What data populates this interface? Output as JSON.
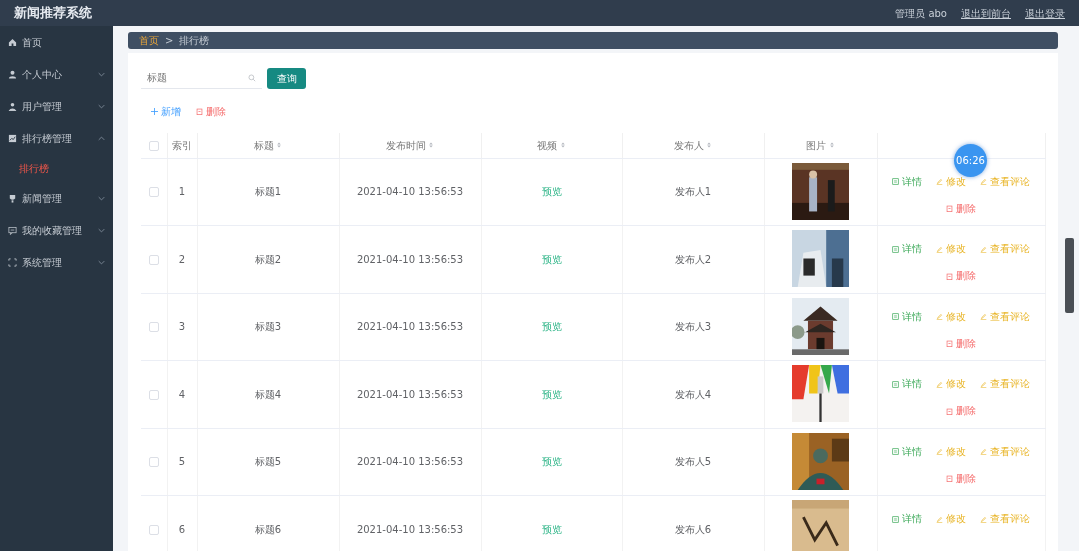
{
  "app_title": "新闻推荐系统",
  "top_links": [
    {
      "label": "管理员 abo",
      "kind": "text"
    },
    {
      "label": "退出到前台",
      "kind": "link"
    },
    {
      "label": "退出登录",
      "kind": "link"
    }
  ],
  "sidebar": {
    "items": [
      {
        "label": "首页",
        "expandable": false
      },
      {
        "label": "个人中心",
        "expandable": true,
        "expanded": false
      },
      {
        "label": "用户管理",
        "expandable": true,
        "expanded": false
      },
      {
        "label": "排行榜管理",
        "expandable": true,
        "expanded": true,
        "children": [
          {
            "label": "排行榜",
            "selected": true
          }
        ]
      },
      {
        "label": "新闻管理",
        "expandable": true,
        "expanded": false
      },
      {
        "label": "我的收藏管理",
        "expandable": true,
        "expanded": false
      },
      {
        "label": "系统管理",
        "expandable": true,
        "expanded": false
      }
    ]
  },
  "breadcrumb": [
    {
      "label": "首页",
      "kind": "link"
    },
    {
      "label": ">",
      "kind": "separator"
    },
    {
      "label": "排行榜",
      "kind": "current"
    }
  ],
  "search": {
    "placeholder": "标题",
    "button": "查询"
  },
  "toolbar": [
    {
      "label": "新增",
      "kind": "add"
    },
    {
      "label": "删除",
      "kind": "delete"
    }
  ],
  "table": {
    "select_all_checked": false,
    "columns": [
      {
        "label": "索引",
        "sortable": false
      },
      {
        "label": "标题",
        "sortable": true
      },
      {
        "label": "发布时间",
        "sortable": true
      },
      {
        "label": "视频",
        "sortable": true
      },
      {
        "label": "发布人",
        "sortable": true
      },
      {
        "label": "图片",
        "sortable": true
      },
      {
        "sortable": false
      }
    ],
    "rows": [
      {
        "checked": false,
        "index": "1",
        "title": "标题1",
        "time": "2021-04-10 13:56:53",
        "video": "预览",
        "publisher": "发布人1",
        "image": {
          "kind": "picture"
        },
        "actions": [
          {
            "label": "详情",
            "kind": "detail"
          },
          {
            "label": "修改",
            "kind": "edit"
          },
          {
            "label": "查看评论",
            "kind": "comment"
          },
          {
            "label": "删除",
            "kind": "delete"
          }
        ]
      },
      {
        "checked": false,
        "index": "2",
        "title": "标题2",
        "time": "2021-04-10 13:56:53",
        "video": "预览",
        "publisher": "发布人2",
        "image": {
          "kind": "picture"
        },
        "actions": [
          {
            "label": "详情",
            "kind": "detail"
          },
          {
            "label": "修改",
            "kind": "edit"
          },
          {
            "label": "查看评论",
            "kind": "comment"
          },
          {
            "label": "删除",
            "kind": "delete"
          }
        ]
      },
      {
        "checked": false,
        "index": "3",
        "title": "标题3",
        "time": "2021-04-10 13:56:53",
        "video": "预览",
        "publisher": "发布人3",
        "image": {
          "kind": "picture"
        },
        "actions": [
          {
            "label": "详情",
            "kind": "detail"
          },
          {
            "label": "修改",
            "kind": "edit"
          },
          {
            "label": "查看评论",
            "kind": "comment"
          },
          {
            "label": "删除",
            "kind": "delete"
          }
        ]
      },
      {
        "checked": false,
        "index": "4",
        "title": "标题4",
        "time": "2021-04-10 13:56:53",
        "video": "预览",
        "publisher": "发布人4",
        "image": {
          "kind": "picture"
        },
        "actions": [
          {
            "label": "详情",
            "kind": "detail"
          },
          {
            "label": "修改",
            "kind": "edit"
          },
          {
            "label": "查看评论",
            "kind": "comment"
          },
          {
            "label": "删除",
            "kind": "delete"
          }
        ]
      },
      {
        "checked": false,
        "index": "5",
        "title": "标题5",
        "time": "2021-04-10 13:56:53",
        "video": "预览",
        "publisher": "发布人5",
        "image": {
          "kind": "picture"
        },
        "actions": [
          {
            "label": "详情",
            "kind": "detail"
          },
          {
            "label": "修改",
            "kind": "edit"
          },
          {
            "label": "查看评论",
            "kind": "comment"
          },
          {
            "label": "删除",
            "kind": "delete"
          }
        ]
      },
      {
        "checked": false,
        "index": "6",
        "title": "标题6",
        "time": "2021-04-10 13:56:53",
        "video": "预览",
        "publisher": "发布人6",
        "image": {
          "kind": "picture"
        },
        "actions": [
          {
            "label": "详情",
            "kind": "detail"
          },
          {
            "label": "修改",
            "kind": "edit"
          },
          {
            "label": "查看评论",
            "kind": "comment"
          }
        ]
      }
    ]
  },
  "timer": "06:26"
}
